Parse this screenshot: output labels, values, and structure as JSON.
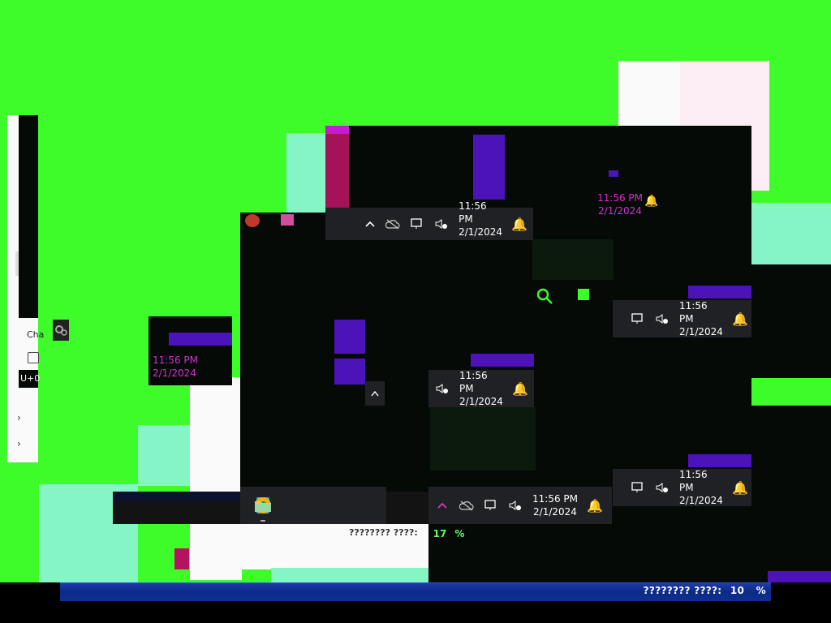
{
  "tray": {
    "time": "11:56 PM",
    "date": "2/1/2024",
    "chevron_glyph": "^"
  },
  "partial_window": {
    "label_cha": "Cha",
    "label_unicode": "U+0"
  },
  "progress_main": {
    "label": "???????? ????:",
    "value": "10",
    "unit": "%"
  },
  "progress_small": {
    "label": "???????? ????:",
    "value": "17",
    "unit": "%"
  },
  "taskbar_apps": [
    "notepad-icon",
    "settings-icon",
    "browser-icon",
    "folder-icon"
  ],
  "colors": {
    "background": "#3dfc2a",
    "taskbar": "#202124",
    "accent_purple": "#4b13b8",
    "progress_blue": "#0a2a88"
  }
}
